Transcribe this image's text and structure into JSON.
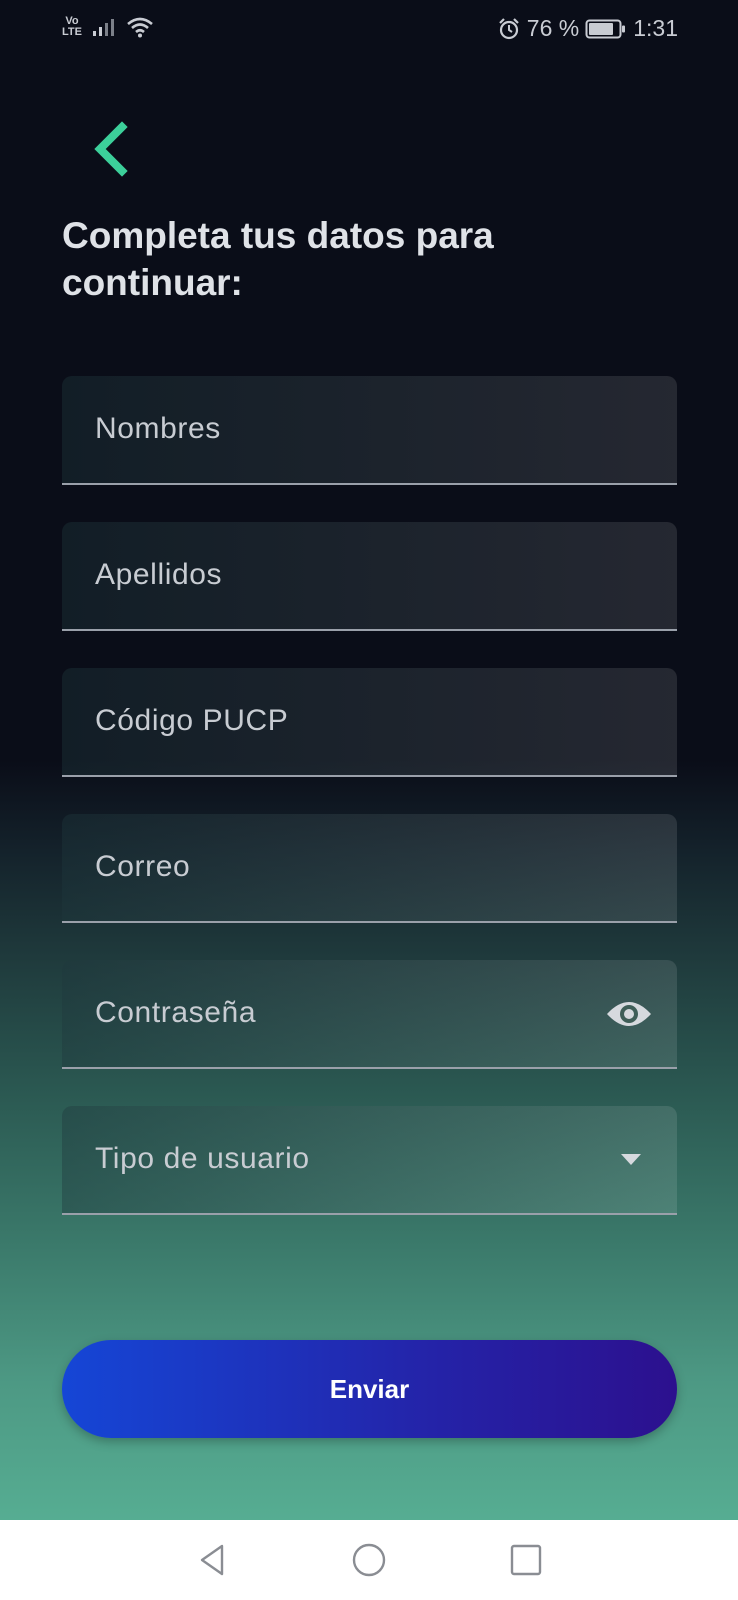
{
  "status_bar": {
    "network": "Vo LTE",
    "network_top": "Vo",
    "network_bottom": "LTE",
    "battery": "76 %",
    "time": "1:31"
  },
  "header": {
    "title": "Completa tus datos para continuar:"
  },
  "form": {
    "fields": [
      {
        "label": "Nombres"
      },
      {
        "label": "Apellidos"
      },
      {
        "label": "Código PUCP"
      },
      {
        "label": "Correo"
      },
      {
        "label": "Contraseña"
      },
      {
        "label": "Tipo de usuario"
      }
    ],
    "submit_label": "Enviar"
  },
  "icons": {
    "back": "back-chevron-icon",
    "password_toggle": "eye-icon",
    "dropdown": "caret-down-icon",
    "nav_back": "triangle-back-icon",
    "nav_home": "circle-home-icon",
    "nav_recents": "square-recents-icon"
  },
  "colors": {
    "accent": "#3ccf9a",
    "button_start": "#1546d6",
    "button_end": "#2c108e",
    "background_top": "#0a0d18",
    "background_bottom": "#56ad92"
  }
}
